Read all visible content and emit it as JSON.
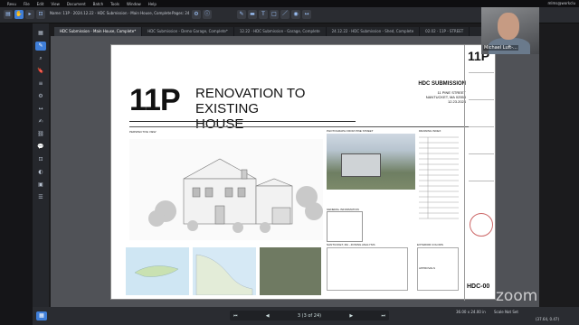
{
  "mac_menu": [
    "Revu",
    "File",
    "Edit",
    "View",
    "Document",
    "Batch",
    "Tools",
    "Window",
    "Help"
  ],
  "mac_right": "mlms@workclu",
  "toolbar": {
    "doc_title": "Name: 11P · 2024.12.22 · HDC Submission · Main House, Complete",
    "pages_label": "Pages: 24"
  },
  "tabs": [
    {
      "label": "HDC Submission - Main House, Complete*",
      "active": true
    },
    {
      "label": "HDC Submission - Demo Garage, Complete*",
      "active": false
    },
    {
      "label": "12.22 · HDC Submission - Garage, Complete",
      "active": false
    },
    {
      "label": "24.12.22 · HDC Submission - Shed, Complete",
      "active": false
    },
    {
      "label": "02.02 · 11P - STREET",
      "active": false
    }
  ],
  "sheet": {
    "number": "11P",
    "title_line1": "RENOVATION TO EXISTING",
    "title_line2": "HOUSE",
    "submission": "HDC SUBMISSION",
    "address1": "11 PINE STREET",
    "address2": "NANTUCKET, MA 02554",
    "date": "12.23.2024",
    "perspective_label": "PERSPECTIVE VIEW",
    "photo_label": "PHOTOGRAPH FROM PINE STREET",
    "index_label": "DRAWING INDEX",
    "gen_info_label": "GENERAL INFORMATION",
    "zoning_label": "NANTUCKET, MA - ZONING ANALYSIS",
    "ext_label": "EXTERIOR COLORS",
    "approvals_label": "APPROVALS",
    "sheet_id": "HDC-00",
    "tb_number": "11P"
  },
  "video": {
    "name": "Michael Luft-..."
  },
  "zoom_watermark": "zoom",
  "status": {
    "page_indicator": "3 (3 of 24)",
    "sheet_size": "36.00 x 24.00 in",
    "scale": "Scale Not Set",
    "coords": "(37.64, 0.47)"
  }
}
